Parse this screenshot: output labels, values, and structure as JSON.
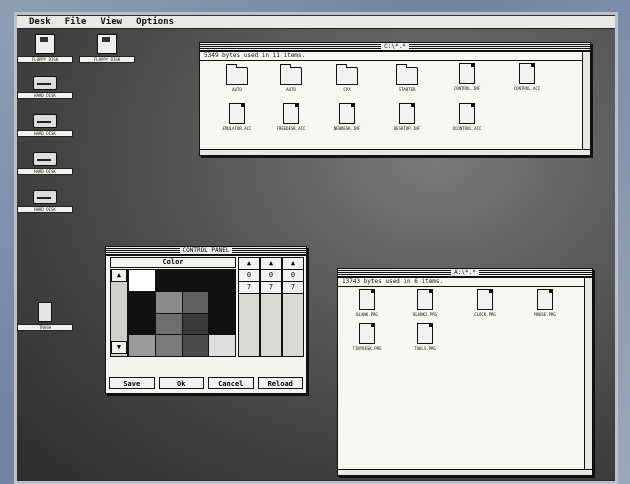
{
  "menu": [
    "Desk",
    "File",
    "View",
    "Options"
  ],
  "desktop_icons": [
    {
      "kind": "floppy-disk-icon",
      "label": "FLOPPY DISK"
    },
    {
      "kind": "floppy-disk-icon",
      "label": "FLOPPY DISK"
    },
    {
      "kind": "hard-disk-icon",
      "label": "HARD DISK"
    },
    {
      "kind": "hard-disk-icon",
      "label": "HARD DISK"
    },
    {
      "kind": "hard-disk-icon",
      "label": "HARD DISK"
    },
    {
      "kind": "hard-disk-icon",
      "label": "HARD DISK"
    },
    {
      "kind": "trash-icon",
      "label": "TRASH"
    }
  ],
  "window_top": {
    "title": "C:\\*.*",
    "info": "5349 bytes used in 11 items.",
    "items": [
      {
        "type": "folder",
        "name": "AUTO"
      },
      {
        "type": "folder",
        "name": "AUTO"
      },
      {
        "type": "folder",
        "name": "CPX"
      },
      {
        "type": "folder",
        "name": "STARTER"
      },
      {
        "type": "doc",
        "name": "CONTROL.INF"
      },
      {
        "type": "doc",
        "name": "CONTROL.ACC"
      },
      {
        "type": "doc",
        "name": "EMULATOR.ACC"
      },
      {
        "type": "doc",
        "name": "FREEDESK.ACC"
      },
      {
        "type": "doc",
        "name": "NEWDESK.INF"
      },
      {
        "type": "doc",
        "name": "DESKTOP.INF"
      },
      {
        "type": "doc",
        "name": "XCONTROL.ACC"
      }
    ]
  },
  "window_bottom": {
    "title": "A:\\*.*",
    "info": "13743 bytes used in 6 items.",
    "items": [
      {
        "type": "doc",
        "name": "BLANK.PRG"
      },
      {
        "type": "doc",
        "name": "BLANK2.PRG"
      },
      {
        "type": "doc",
        "name": "CLOCK.PRG"
      },
      {
        "type": "doc",
        "name": "MOUSE.PRG"
      },
      {
        "type": "doc",
        "name": "TINYDESK.PRG"
      },
      {
        "type": "doc",
        "name": "TOOLS.PRG"
      }
    ]
  },
  "control_panel": {
    "title": "CONTROL PANEL",
    "color_header": "Color",
    "swatches": [
      "#ffffff",
      "#111111",
      "#111111",
      "#111111",
      "#111111",
      "#8a8a8a",
      "#5e5e5e",
      "#111111",
      "#111111",
      "#6e6e6e",
      "#3a3a3a",
      "#111111",
      "#9a9a9a",
      "#7a7a7a",
      "#4a4a4a",
      "#dedede"
    ],
    "slider_values": [
      "0",
      "7"
    ],
    "buttons": [
      "Save",
      "Ok",
      "Cancel",
      "Reload"
    ]
  }
}
